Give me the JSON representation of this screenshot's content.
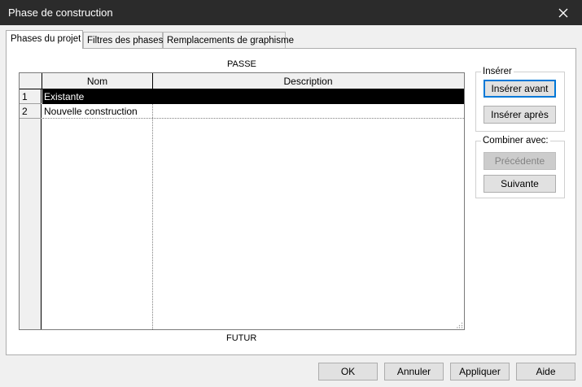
{
  "window": {
    "title": "Phase de construction"
  },
  "tabs": [
    {
      "label": "Phases du projet",
      "active": true
    },
    {
      "label": "Filtres des phases",
      "active": false
    },
    {
      "label": "Remplacements de graphisme",
      "active": false
    }
  ],
  "labels": {
    "past": "PASSE",
    "future": "FUTUR"
  },
  "table": {
    "columns": [
      "Nom",
      "Description"
    ],
    "rows": [
      {
        "num": "1",
        "name": "Existante",
        "description": "",
        "selected": true
      },
      {
        "num": "2",
        "name": "Nouvelle construction",
        "description": "",
        "selected": false
      }
    ]
  },
  "insert_group": {
    "legend": "Insérer",
    "before": "Insérer avant",
    "after": "Insérer après"
  },
  "combine_group": {
    "legend": "Combiner avec:",
    "previous": "Précédente",
    "next": "Suivante"
  },
  "footer": {
    "ok": "OK",
    "cancel": "Annuler",
    "apply": "Appliquer",
    "help": "Aide"
  },
  "colors": {
    "titlebar": "#2b2b2b",
    "selection": "#000000",
    "default_button_border": "#0078d7"
  },
  "icons": {
    "close": "close-icon"
  }
}
